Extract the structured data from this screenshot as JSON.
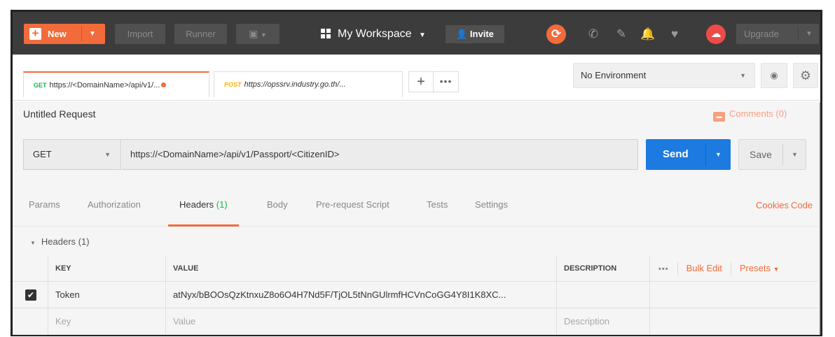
{
  "topbar": {
    "new_label": "New",
    "import_label": "Import",
    "runner_label": "Runner",
    "workspace_label": "My Workspace",
    "invite_label": "Invite",
    "upgrade_label": "Upgrade"
  },
  "tabs": [
    {
      "method": "GET",
      "label": "https://<DomainName>/api/v1/..."
    },
    {
      "method": "POST",
      "label": "https://opssrv.industry.go.th/..."
    }
  ],
  "environment": {
    "selected": "No Environment"
  },
  "request": {
    "title": "Untitled Request",
    "comments_label": "Comments (0)",
    "method": "GET",
    "url": "https://<DomainName>/api/v1/Passport/<CitizenID>",
    "send_label": "Send",
    "save_label": "Save"
  },
  "subtabs": {
    "params": "Params",
    "authorization": "Authorization",
    "headers": "Headers",
    "headers_count": "(1)",
    "body": "Body",
    "prerequest": "Pre-request Script",
    "tests": "Tests",
    "settings": "Settings",
    "cookies": "Cookies",
    "code": "Code"
  },
  "headers_section": {
    "title": "Headers (1)",
    "columns": {
      "key": "KEY",
      "value": "VALUE",
      "description": "DESCRIPTION",
      "bulk_edit": "Bulk Edit",
      "presets": "Presets"
    },
    "rows": [
      {
        "checked": true,
        "key": "Token",
        "value": "atNyx/bBOOsQzKtnxuZ8o6O4H7Nd5F/TjOL5tNnGUlrmfHCVnCoGG4Y8I1K8XC..."
      }
    ],
    "placeholders": {
      "key": "Key",
      "value": "Value",
      "description": "Description"
    }
  },
  "colors": {
    "accent": "#f26b3a",
    "send": "#1c7ae0",
    "get": "#0cbb52",
    "post": "#ffb400"
  }
}
